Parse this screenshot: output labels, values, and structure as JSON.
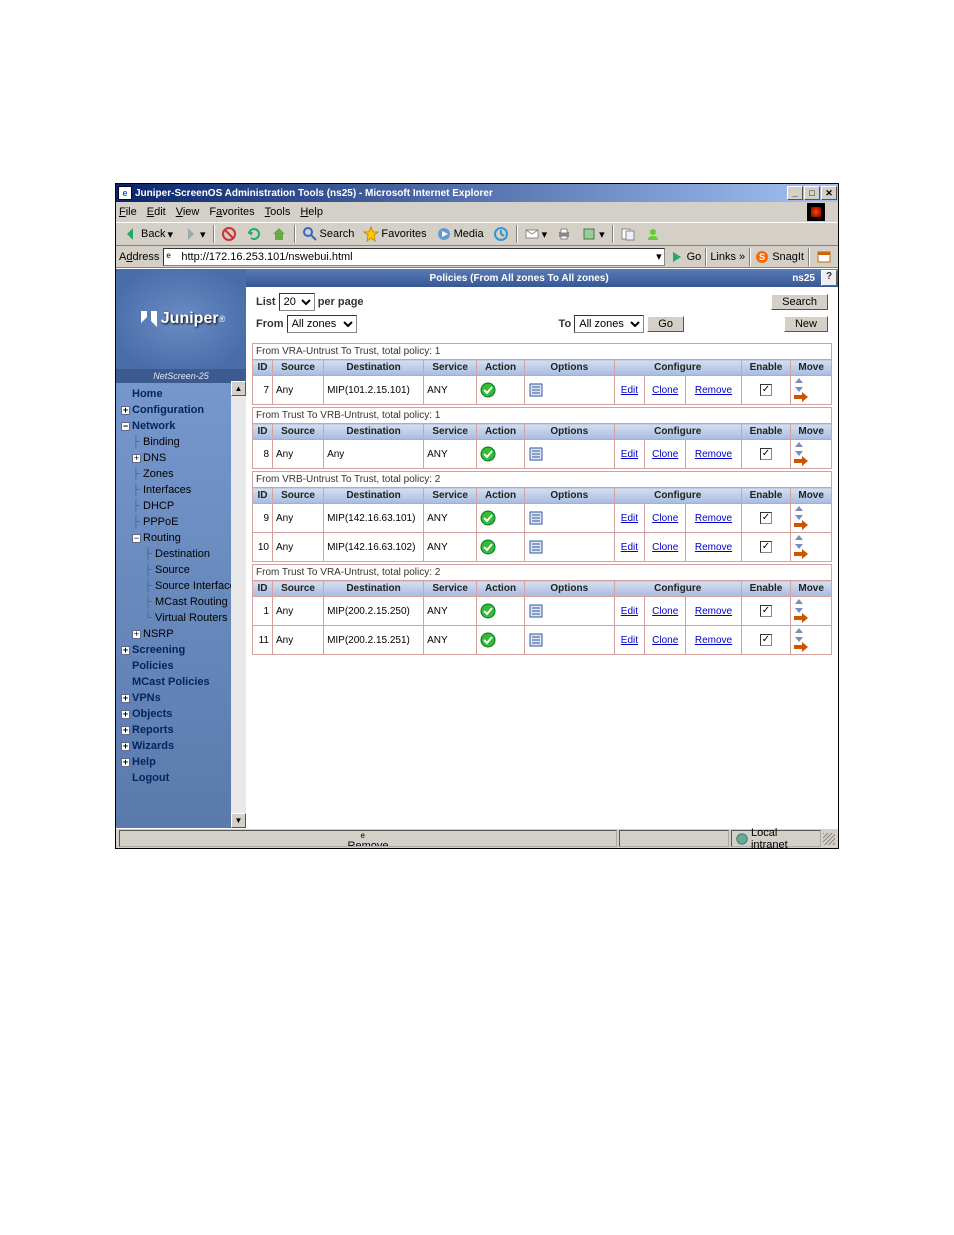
{
  "window": {
    "title": "Juniper-ScreenOS Administration Tools (ns25) - Microsoft Internet Explorer"
  },
  "menu": {
    "file": "File",
    "edit": "Edit",
    "view": "View",
    "favorites": "Favorites",
    "tools": "Tools",
    "help": "Help"
  },
  "toolbar": {
    "back": "Back",
    "search": "Search",
    "favorites": "Favorites",
    "media": "Media"
  },
  "address": {
    "label": "Address",
    "url": "http://172.16.253.101/nswebui.html",
    "go": "Go",
    "links": "Links",
    "snagit": "SnagIt"
  },
  "sidebar": {
    "device": "NetScreen-25",
    "brand": "Juniper",
    "home": "Home",
    "configuration": "Configuration",
    "network": "Network",
    "binding": "Binding",
    "dns": "DNS",
    "zones": "Zones",
    "interfaces": "Interfaces",
    "dhcp": "DHCP",
    "pppoe": "PPPoE",
    "routing": "Routing",
    "dest": "Destination",
    "source": "Source",
    "srcif": "Source Interface",
    "mcast": "MCast Routing",
    "vrouters": "Virtual Routers",
    "nsrp": "NSRP",
    "screening": "Screening",
    "policies": "Policies",
    "mcastpol": "MCast Policies",
    "vpns": "VPNs",
    "objects": "Objects",
    "reports": "Reports",
    "wizards": "Wizards",
    "help": "Help",
    "logout": "Logout"
  },
  "header": {
    "title": "Policies (From All zones To All zones)",
    "devname": "ns25"
  },
  "controls": {
    "list": "List",
    "per_page_val": "20",
    "per_page": "per page",
    "search": "Search",
    "from": "From",
    "from_val": "All zones",
    "to": "To",
    "to_val": "All zones",
    "go": "Go",
    "new": "New"
  },
  "cols": {
    "id": "ID",
    "src": "Source",
    "dst": "Destination",
    "svc": "Service",
    "act": "Action",
    "opt": "Options",
    "cfg": "Configure",
    "en": "Enable",
    "mv": "Move"
  },
  "links": {
    "edit": "Edit",
    "clone": "Clone",
    "remove": "Remove"
  },
  "groups": [
    {
      "title": "From VRA-Untrust To Trust, total policy: 1",
      "rows": [
        {
          "id": "7",
          "src": "Any",
          "dst": "MIP(101.2.15.101)",
          "svc": "ANY",
          "en": true
        }
      ]
    },
    {
      "title": "From Trust To VRB-Untrust, total policy: 1",
      "rows": [
        {
          "id": "8",
          "src": "Any",
          "dst": "Any",
          "svc": "ANY",
          "en": true
        }
      ]
    },
    {
      "title": "From VRB-Untrust To Trust, total policy: 2",
      "rows": [
        {
          "id": "9",
          "src": "Any",
          "dst": "MIP(142.16.63.101)",
          "svc": "ANY",
          "en": true
        },
        {
          "id": "10",
          "src": "Any",
          "dst": "MIP(142.16.63.102)",
          "svc": "ANY",
          "en": true
        }
      ]
    },
    {
      "title": "From Trust To VRA-Untrust, total policy: 2",
      "rows": [
        {
          "id": "1",
          "src": "Any",
          "dst": "MIP(200.2.15.250)",
          "svc": "ANY",
          "en": true
        },
        {
          "id": "11",
          "src": "Any",
          "dst": "MIP(200.2.15.251)",
          "svc": "ANY",
          "en": true
        }
      ]
    }
  ],
  "status": {
    "msg": "Remove",
    "zone": "Local intranet"
  }
}
